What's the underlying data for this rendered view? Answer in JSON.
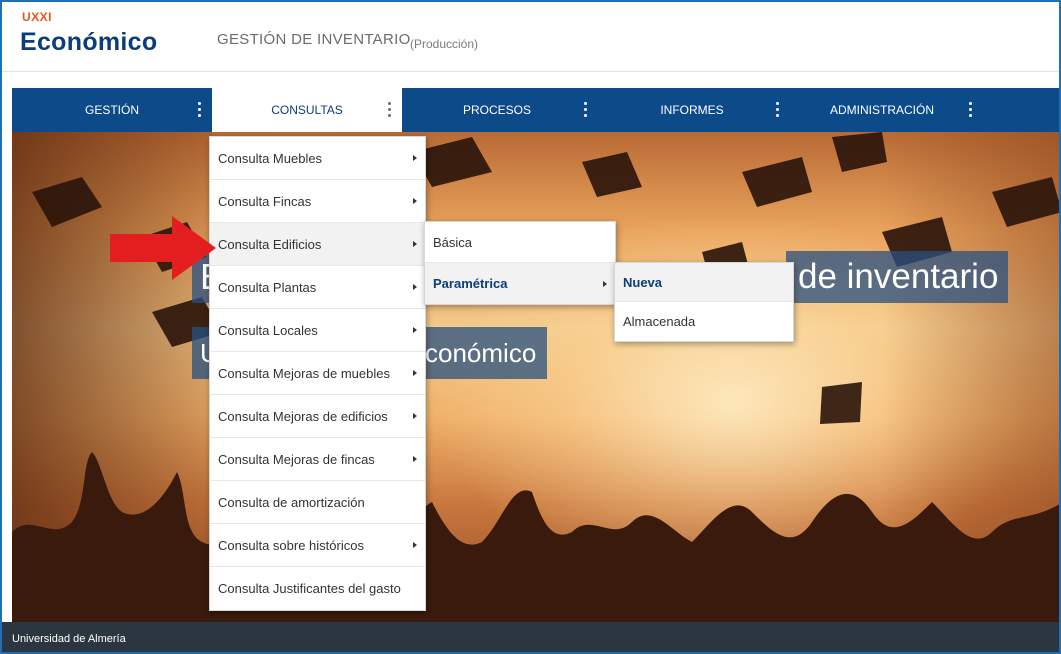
{
  "header": {
    "logo_small": "UXXI",
    "logo_main": "Económico",
    "app_title": "GESTIÓN DE INVENTARIO",
    "app_env": "(Producción)"
  },
  "nav": {
    "items": [
      {
        "label": "GESTIÓN"
      },
      {
        "label": "CONSULTAS"
      },
      {
        "label": "PROCESOS"
      },
      {
        "label": "INFORMES"
      },
      {
        "label": "ADMINISTRACIÓN"
      }
    ]
  },
  "hero": {
    "title_left": "E",
    "title_right": "de inventario",
    "subtitle_left": "U",
    "subtitle_right": "conómico"
  },
  "menu_consultas": {
    "items": [
      {
        "label": "Consulta Muebles",
        "submenu": true
      },
      {
        "label": "Consulta Fincas",
        "submenu": true
      },
      {
        "label": "Consulta Edificios",
        "submenu": true
      },
      {
        "label": "Consulta Plantas",
        "submenu": true
      },
      {
        "label": "Consulta Locales",
        "submenu": true
      },
      {
        "label": "Consulta Mejoras de muebles",
        "submenu": true
      },
      {
        "label": "Consulta Mejoras de edificios",
        "submenu": true
      },
      {
        "label": "Consulta Mejoras de fincas",
        "submenu": true
      },
      {
        "label": "Consulta de amortización",
        "submenu": false
      },
      {
        "label": "Consulta sobre históricos",
        "submenu": true
      },
      {
        "label": "Consulta Justificantes del gasto",
        "submenu": false
      }
    ]
  },
  "menu_edificios": {
    "items": [
      {
        "label": "Básica"
      },
      {
        "label": "Paramétrica"
      }
    ]
  },
  "menu_parametrica": {
    "items": [
      {
        "label": "Nueva"
      },
      {
        "label": "Almacenada"
      }
    ]
  },
  "footer": {
    "text": "Universidad de Almería"
  },
  "colors": {
    "nav_bg": "#0d4a8a",
    "brand_orange": "#e8541a",
    "brand_blue": "#0b3d7a",
    "footer_bg": "#2c3640",
    "annotation_red": "#e41e1e"
  }
}
